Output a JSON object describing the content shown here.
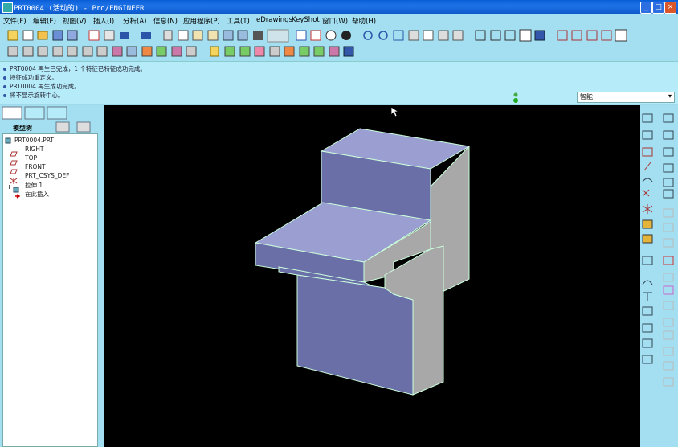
{
  "window": {
    "title": "PRT0004 (活动的) - Pro/ENGINEER",
    "minimize_glyph": "_",
    "maximize_glyph": "□",
    "close_glyph": "×"
  },
  "menubar": [
    {
      "label": "文件(F)"
    },
    {
      "label": "编辑(E)"
    },
    {
      "label": "视图(V)"
    },
    {
      "label": "插入(I)"
    },
    {
      "label": "分析(A)"
    },
    {
      "label": "信息(N)"
    },
    {
      "label": "应用程序(P)"
    },
    {
      "label": "工具(T)"
    },
    {
      "label": "eDrawings"
    },
    {
      "label": "KeyShot"
    },
    {
      "label": "窗口(W)"
    },
    {
      "label": "帮助(H)"
    }
  ],
  "messages": [
    "PRT0004 再生已完成，1 个特征已特征成功完成。",
    "特征成功重定义。",
    "PRT0004 再生成功完成。",
    "将不显示旋转中心。"
  ],
  "filter": {
    "value": "智能",
    "arrow": "▾"
  },
  "navigator": {
    "panel_title": "模型树",
    "items": [
      {
        "label": "PRT0004.PRT"
      },
      {
        "label": "RIGHT"
      },
      {
        "label": "TOP"
      },
      {
        "label": "FRONT"
      },
      {
        "label": "PRT_CSYS_DEF"
      },
      {
        "label": "拉伸 1"
      },
      {
        "label": "在此插入"
      }
    ],
    "expand_glyph": "+"
  },
  "colors": {
    "title_bar": "#0b56c8",
    "chrome": "#a3dff0",
    "viewport_bg": "#000000",
    "model_top": "#9a9ed0",
    "model_front": "#6b6fa8",
    "model_side": "#a8a8a8"
  }
}
